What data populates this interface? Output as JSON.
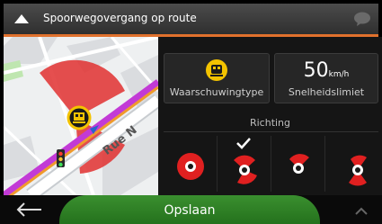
{
  "header": {
    "title": "Spoorwegovergang op route"
  },
  "map": {
    "street_label": "Rue N"
  },
  "warning_type": {
    "label": "Waarschuwingtype",
    "icon": "train-icon"
  },
  "speed_limit": {
    "value": "50",
    "unit": "km/h",
    "label": "Snelheidslimiet"
  },
  "direction": {
    "label": "Richting",
    "options": [
      {
        "name": "all-directions",
        "selected": false
      },
      {
        "name": "forward",
        "selected": true
      },
      {
        "name": "backward",
        "selected": false
      },
      {
        "name": "both",
        "selected": false
      }
    ]
  },
  "footer": {
    "save_label": "Opslaan"
  },
  "colors": {
    "accent": "#e0712d",
    "save_button": "#2e7d22",
    "danger": "#e02020"
  }
}
